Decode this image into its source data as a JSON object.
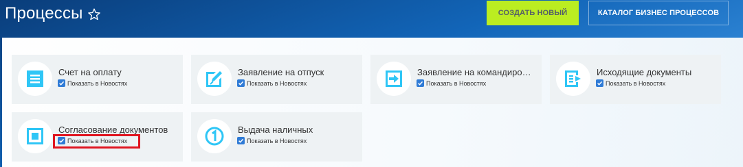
{
  "header": {
    "title": "Процессы",
    "create_button": "СОЗДАТЬ НОВЫЙ",
    "catalog_button": "КАТАЛОГ БИЗНЕС ПРОЦЕССОВ"
  },
  "colors": {
    "accent_green": "#bbed21",
    "icon_blue": "#2fc6f6",
    "checkbox_blue": "#2f7bd6",
    "highlight_red": "#e0141f"
  },
  "cards": [
    {
      "title": "Счет на оплату",
      "checkbox_label": "Показать в Новостях",
      "checked": true,
      "icon": "invoice-icon"
    },
    {
      "title": "Заявление на отпуск",
      "checkbox_label": "Показать в Новостях",
      "checked": true,
      "icon": "edit-document-icon"
    },
    {
      "title": "Заявление на командиро…",
      "checkbox_label": "Показать в Новостях",
      "checked": true,
      "icon": "arrow-right-icon"
    },
    {
      "title": "Исходящие документы",
      "checkbox_label": "Показать в Новостях",
      "checked": true,
      "icon": "outgoing-documents-icon"
    },
    {
      "title": "Согласование документов",
      "checkbox_label": "Показать в Новостях",
      "checked": true,
      "icon": "approval-icon"
    },
    {
      "title": "Выдача наличных",
      "checkbox_label": "Показать в Новостях",
      "checked": true,
      "icon": "cash-coin-icon"
    }
  ]
}
